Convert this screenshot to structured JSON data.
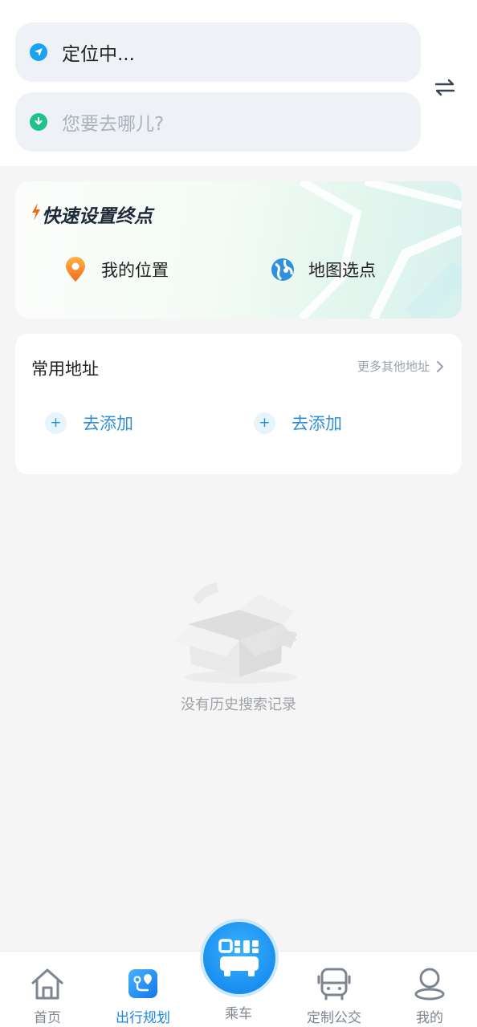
{
  "search": {
    "from_value": "定位中...",
    "to_placeholder": "您要去哪儿?"
  },
  "quick": {
    "title": "快速设置终点",
    "items": [
      {
        "label": "我的位置",
        "icon": "location-pin-icon"
      },
      {
        "label": "地图选点",
        "icon": "map-globe-icon"
      }
    ]
  },
  "common": {
    "title": "常用地址",
    "more_label": "更多其他地址",
    "add_items": [
      {
        "label": "去添加"
      },
      {
        "label": "去添加"
      }
    ]
  },
  "history": {
    "empty_text": "没有历史搜索记录"
  },
  "tabbar": {
    "items": [
      {
        "label": "首页",
        "icon": "home-icon",
        "active": false
      },
      {
        "label": "出行规划",
        "icon": "route-plan-icon",
        "active": true
      },
      {
        "label": "乘车",
        "icon": "bus-qr-icon",
        "active": false
      },
      {
        "label": "定制公交",
        "icon": "bus-icon",
        "active": false
      },
      {
        "label": "我的",
        "icon": "user-icon",
        "active": false
      }
    ]
  },
  "colors": {
    "accent": "#1b86e8",
    "from_dot": "#1aa3f0",
    "to_dot": "#22c08a",
    "link_blue": "#2f8fd6",
    "brand_orange": "#f36a12"
  }
}
